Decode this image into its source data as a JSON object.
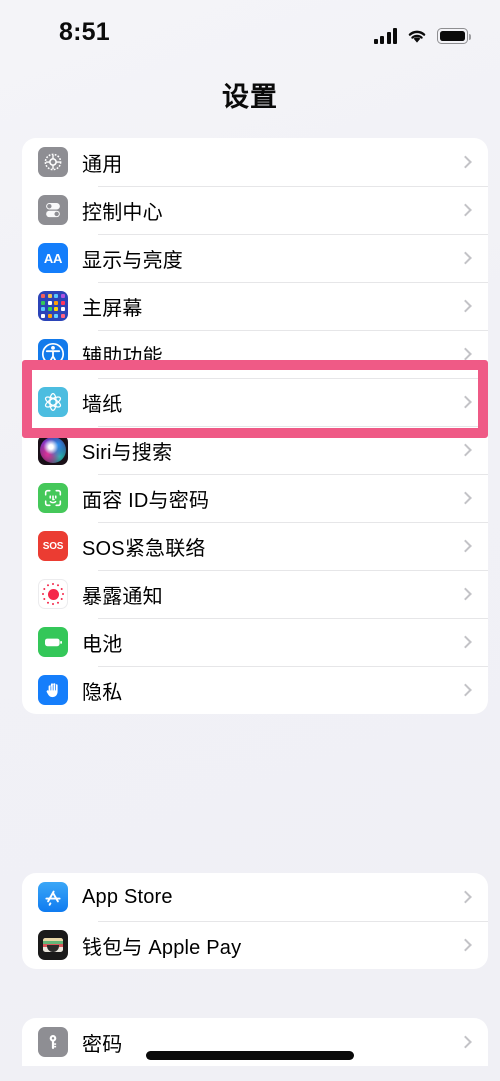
{
  "status_bar": {
    "time": "8:51",
    "signal_icon": "cellular-bars-icon",
    "wifi_icon": "wifi-icon",
    "battery_icon": "battery-full-icon"
  },
  "nav": {
    "title": "设置"
  },
  "highlight": {
    "target": "辅助功能",
    "color": "#ef5a86"
  },
  "groups": [
    {
      "id": "group-1",
      "rows": [
        {
          "label": "通用",
          "icon": "gear-icon",
          "icon_color": "#8e8e93"
        },
        {
          "label": "控制中心",
          "icon": "control-center-icon",
          "icon_color": "#8e8e93"
        },
        {
          "label": "显示与亮度",
          "icon": "display-brightness-icon",
          "icon_color": "#147efb"
        },
        {
          "label": "主屏幕",
          "icon": "home-screen-icon",
          "icon_color": "#2b44b8"
        },
        {
          "label": "辅助功能",
          "icon": "accessibility-icon",
          "icon_color": "#137aeb"
        },
        {
          "label": "墙纸",
          "icon": "wallpaper-icon",
          "icon_color": "#4cbde0"
        },
        {
          "label": "Siri与搜索",
          "icon": "siri-icon",
          "icon_color": "#1a1018"
        },
        {
          "label": "面容 ID与密码",
          "icon": "face-id-icon",
          "icon_color": "#45c85a"
        },
        {
          "label": "SOS紧急联络",
          "icon": "emergency-sos-icon",
          "icon_color": "#eb3c32"
        },
        {
          "label": "暴露通知",
          "icon": "exposure-notification-icon",
          "icon_color": "#f5284a"
        },
        {
          "label": "电池",
          "icon": "battery-icon",
          "icon_color": "#34c759"
        },
        {
          "label": "隐私",
          "icon": "privacy-hand-icon",
          "icon_color": "#157efb"
        }
      ]
    },
    {
      "id": "group-2",
      "rows": [
        {
          "label": "App Store",
          "icon": "app-store-icon",
          "icon_color": "#0f7bf0"
        },
        {
          "label": "钱包与 Apple Pay",
          "icon": "wallet-icon",
          "icon_color": "#1a1a1a"
        }
      ]
    },
    {
      "id": "group-3",
      "rows": [
        {
          "label": "密码",
          "icon": "passwords-key-icon",
          "icon_color": "#8e8e93"
        }
      ]
    }
  ],
  "chevron_icon": "chevron-right-icon",
  "home_indicator": "home-indicator"
}
